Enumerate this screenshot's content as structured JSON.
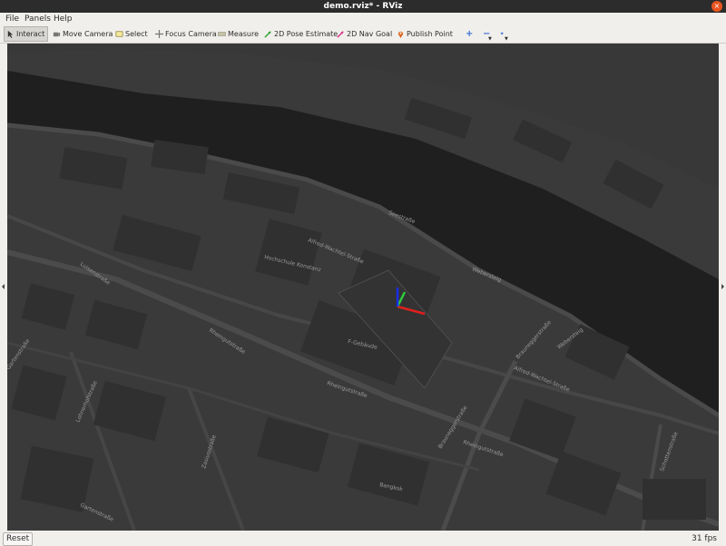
{
  "window": {
    "title": "demo.rviz* - RViz",
    "close_glyph": "×"
  },
  "menubar": {
    "file": "File",
    "panels": "Panels",
    "help": "Help"
  },
  "toolbar": {
    "interact": "Interact",
    "move_camera": "Move Camera",
    "select": "Select",
    "focus_camera": "Focus Camera",
    "measure": "Measure",
    "pose_estimate": "2D Pose Estimate",
    "nav_goal": "2D Nav Goal",
    "publish_point": "Publish Point",
    "add_tool": "+",
    "remove_tool": "−",
    "tool_properties": "⋆"
  },
  "map": {
    "labels": {
      "hochschule": "Hochschule Konstanz",
      "alfred_wachtel_short": "Alfred-Wachtel-Straße",
      "f_gebaeude": "F-Gebäude",
      "rheingut1": "Rheingutstraße",
      "rheingut2": "Rheingutstraße",
      "rheingut3": "Rheingutstraße",
      "alfred_wachtel": "Alfred-Wachtel-Straße",
      "brauneggerstrasse": "Brauneggerstraße",
      "brauneggerstrasse2": "Brauneggerstraße",
      "webersteig": "Webersteig",
      "schottenstrasse": "Schottenstraße",
      "zasiusstrasse": "Zasiusstraße",
      "lohnerhofstrasse": "Lohnerhofstraße",
      "gartenstrasse": "Gartenstraße",
      "gartenstrasse2": "Gartenstraße",
      "bangkok": "Bangkok",
      "seestrasse": "Seestraße",
      "webersteig2": "Webersteig",
      "luisenstrasse": "Luisenstraße"
    },
    "colors": {
      "water": "#1e1e1e",
      "land": "#3a3a3a",
      "road": "#4a4a4a",
      "building": "#2f2f2f",
      "x_axis": "#e0201e",
      "y_axis": "#2ecc40",
      "z_axis": "#1a2ee8"
    }
  },
  "statusbar": {
    "reset": "Reset",
    "fps": "31 fps"
  }
}
